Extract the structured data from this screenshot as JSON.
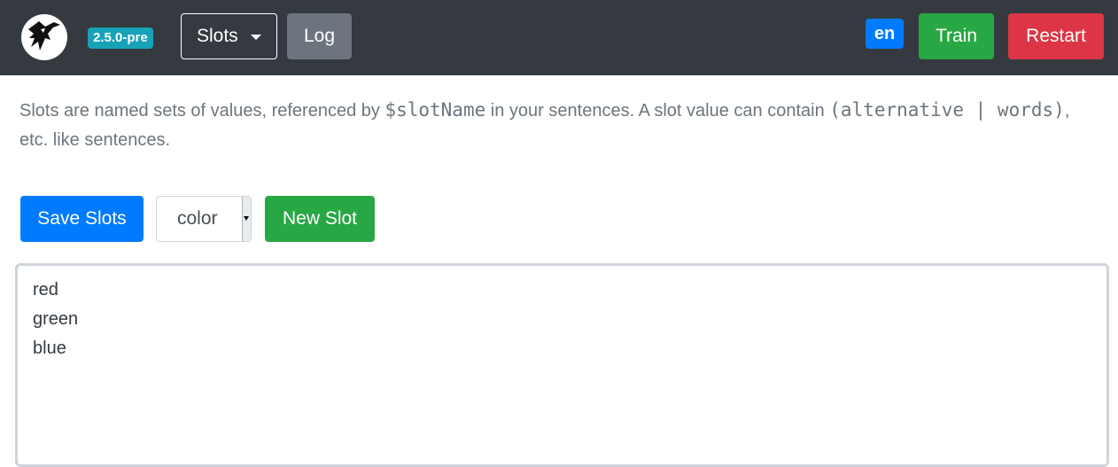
{
  "navbar": {
    "logo_icon": "bird-logo-icon",
    "version": "2.5.0-pre",
    "slots_label": "Slots",
    "log_label": "Log",
    "language": "en",
    "train_label": "Train",
    "restart_label": "Restart"
  },
  "help": {
    "part1": "Slots are named sets of values, referenced by ",
    "code1": "$slotName",
    "part2": " in your sentences. A slot value can contain ",
    "code2": "(alternative | words)",
    "part3": ", etc. like sentences."
  },
  "toolbar": {
    "save_label": "Save Slots",
    "selected_slot": "color",
    "new_label": "New Slot"
  },
  "editor": {
    "lines": [
      "red",
      "green",
      "blue"
    ]
  },
  "colors": {
    "navbar": "#343a40",
    "primary": "#007bff",
    "success": "#28a745",
    "danger": "#dc3545",
    "secondary": "#6c757d",
    "info": "#17a2b8"
  }
}
